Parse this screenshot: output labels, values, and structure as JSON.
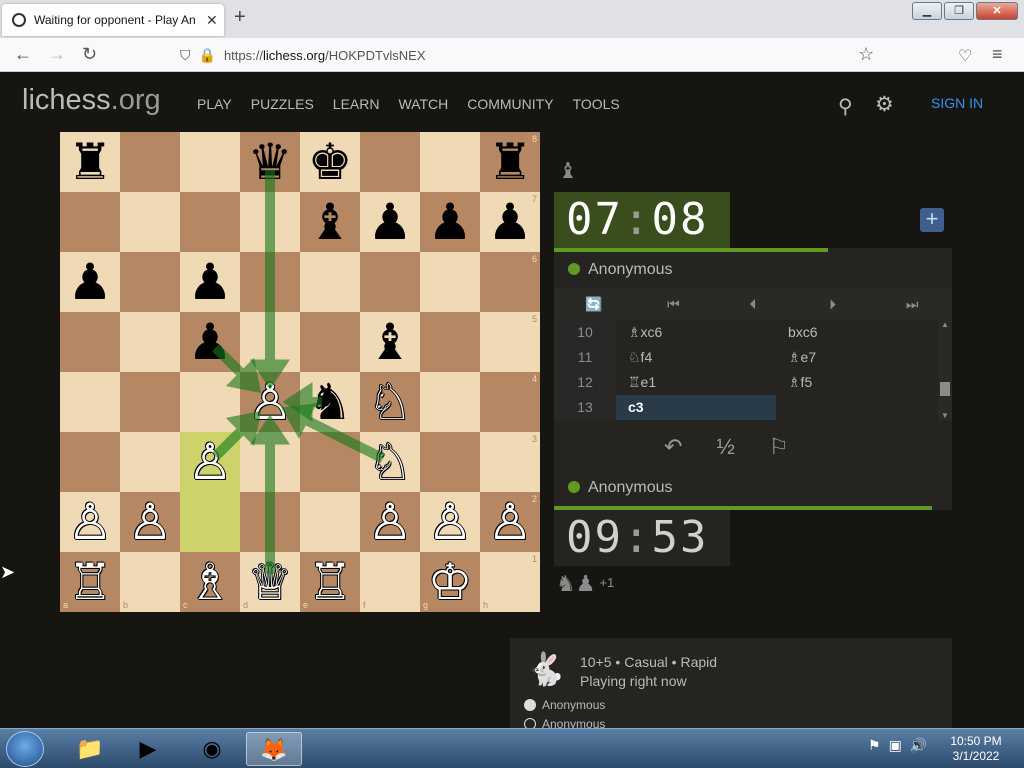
{
  "browser": {
    "tab_title": "Waiting for opponent - Play An",
    "tab_close": "✕",
    "new_tab": "+",
    "url_prefix": "https://",
    "url_host": "lichess.org",
    "url_path": "/HOKPDTvlsNEX",
    "window_buttons": [
      "▁",
      "❐",
      "✕"
    ]
  },
  "site": {
    "logo_main": "lichess",
    "logo_tld": ".org",
    "nav": [
      "PLAY",
      "PUZZLES",
      "LEARN",
      "WATCH",
      "COMMUNITY",
      "TOOLS"
    ],
    "sign_in": "SIGN IN"
  },
  "board": {
    "files": [
      "a",
      "b",
      "c",
      "d",
      "e",
      "f",
      "g",
      "h"
    ],
    "ranks": [
      "8",
      "7",
      "6",
      "5",
      "4",
      "3",
      "2",
      "1"
    ],
    "highlight_squares": [
      "c3",
      "c2"
    ],
    "pieces": [
      {
        "sq": "a8",
        "p": "♜",
        "c": "b"
      },
      {
        "sq": "d8",
        "p": "♛",
        "c": "b"
      },
      {
        "sq": "e8",
        "p": "♚",
        "c": "b"
      },
      {
        "sq": "h8",
        "p": "♜",
        "c": "b"
      },
      {
        "sq": "e7",
        "p": "♝",
        "c": "b"
      },
      {
        "sq": "f7",
        "p": "♟",
        "c": "b"
      },
      {
        "sq": "g7",
        "p": "♟",
        "c": "b"
      },
      {
        "sq": "h7",
        "p": "♟",
        "c": "b"
      },
      {
        "sq": "a6",
        "p": "♟",
        "c": "b"
      },
      {
        "sq": "c6",
        "p": "♟",
        "c": "b"
      },
      {
        "sq": "c5",
        "p": "♟",
        "c": "b"
      },
      {
        "sq": "f5",
        "p": "♝",
        "c": "b"
      },
      {
        "sq": "d4",
        "p": "♙",
        "c": "w"
      },
      {
        "sq": "e4",
        "p": "♞",
        "c": "b"
      },
      {
        "sq": "f4",
        "p": "♘",
        "c": "w"
      },
      {
        "sq": "c3",
        "p": "♙",
        "c": "w"
      },
      {
        "sq": "f3",
        "p": "♘",
        "c": "w"
      },
      {
        "sq": "a2",
        "p": "♙",
        "c": "w"
      },
      {
        "sq": "b2",
        "p": "♙",
        "c": "w"
      },
      {
        "sq": "f2",
        "p": "♙",
        "c": "w"
      },
      {
        "sq": "g2",
        "p": "♙",
        "c": "w"
      },
      {
        "sq": "h2",
        "p": "♙",
        "c": "w"
      },
      {
        "sq": "a1",
        "p": "♖",
        "c": "w"
      },
      {
        "sq": "c1",
        "p": "♗",
        "c": "w"
      },
      {
        "sq": "d1",
        "p": "♕",
        "c": "w"
      },
      {
        "sq": "e1",
        "p": "♖",
        "c": "w"
      },
      {
        "sq": "g1",
        "p": "♔",
        "c": "w"
      }
    ],
    "arrows": [
      {
        "from": "d8",
        "to": "d4"
      },
      {
        "from": "d1",
        "to": "d4"
      },
      {
        "from": "c5",
        "to": "d4"
      },
      {
        "from": "c3",
        "to": "d4"
      },
      {
        "from": "f3",
        "to": "d4"
      },
      {
        "from": "e4",
        "to": "d4"
      }
    ],
    "arrow_color": "#15781b"
  },
  "game": {
    "captured_top": "♝",
    "clock_top_min": "07",
    "clock_top_sec": "08",
    "clock_sep": ":",
    "player_top": "Anonymous",
    "player_bottom": "Anonymous",
    "clock_bot_min": "09",
    "clock_bot_sec": "53",
    "captured_bottom": "♞♟",
    "captured_bottom_extra": "+1",
    "controls": [
      "🔄",
      "⏮",
      "⏴",
      "⏵",
      "⏭"
    ],
    "moves": [
      {
        "num": "10",
        "white": "♗xc6",
        "black": "bxc6"
      },
      {
        "num": "11",
        "white": "♘f4",
        "black": "♗e7"
      },
      {
        "num": "12",
        "white": "♖e1",
        "black": "♗f5"
      },
      {
        "num": "13",
        "white": "c3",
        "black": ""
      }
    ],
    "actions": [
      "↶",
      "½",
      "⚐"
    ],
    "accent_color": "#629924"
  },
  "info": {
    "line1": "10+5 • Casual • Rapid",
    "line2": "Playing right now",
    "player1": "Anonymous",
    "player2": "Anonymous"
  },
  "taskbar": {
    "time": "10:50 PM",
    "date": "3/1/2022"
  }
}
